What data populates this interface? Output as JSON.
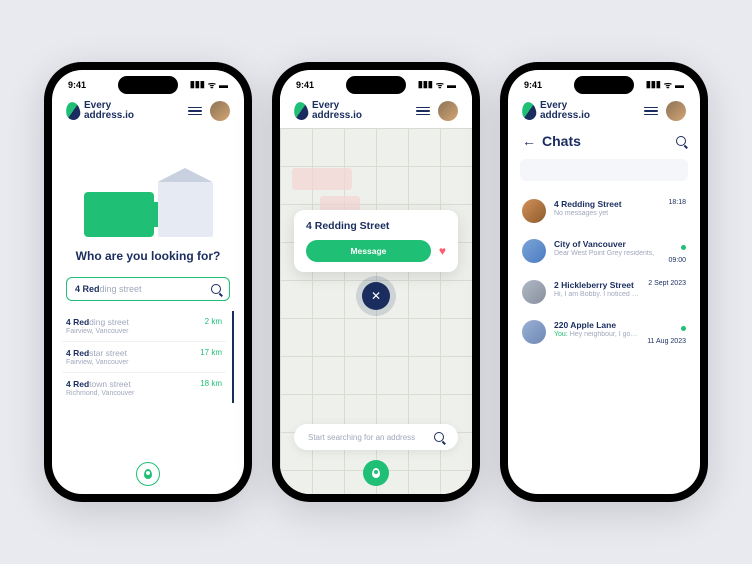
{
  "status": {
    "time": "9:41"
  },
  "brand": {
    "line1": "Every",
    "line2": "address.io"
  },
  "phone1": {
    "heading": "Who are you looking for?",
    "search_bold": "4 Red",
    "search_rest": "ding street",
    "results": [
      {
        "bold": "4 Red",
        "rest": "ding street",
        "sub": "Fairview, Vancouver",
        "dist": "2 km"
      },
      {
        "bold": "4 Red",
        "rest": "star street",
        "sub": "Fairview, Vancouver",
        "dist": "17 km"
      },
      {
        "bold": "4 Red",
        "rest": "town street",
        "sub": "Richmond, Vancouver",
        "dist": "18 km"
      }
    ]
  },
  "phone2": {
    "card_title": "4 Redding Street",
    "message_btn": "Message",
    "search_placeholder": "Start searching for an address"
  },
  "phone3": {
    "title": "Chats",
    "chats": [
      {
        "name": "4 Redding Street",
        "msg": "No messages yet",
        "time": "18:18",
        "dot": false,
        "you": ""
      },
      {
        "name": "City of Vancouver",
        "msg": "Dear West Point Grey residents,",
        "time": "09:00",
        "dot": true,
        "you": ""
      },
      {
        "name": "2 Hickleberry Street",
        "msg": "Hi, I am Bobby. I noticed that your car ...",
        "time": "2 Sept 2023",
        "dot": false,
        "you": ""
      },
      {
        "name": "220 Apple Lane",
        "msg_prefix": "You: ",
        "msg": "Hey neighbour, I got your mail by acci...",
        "time": "11 Aug 2023",
        "dot": true,
        "you": "You: "
      }
    ]
  }
}
